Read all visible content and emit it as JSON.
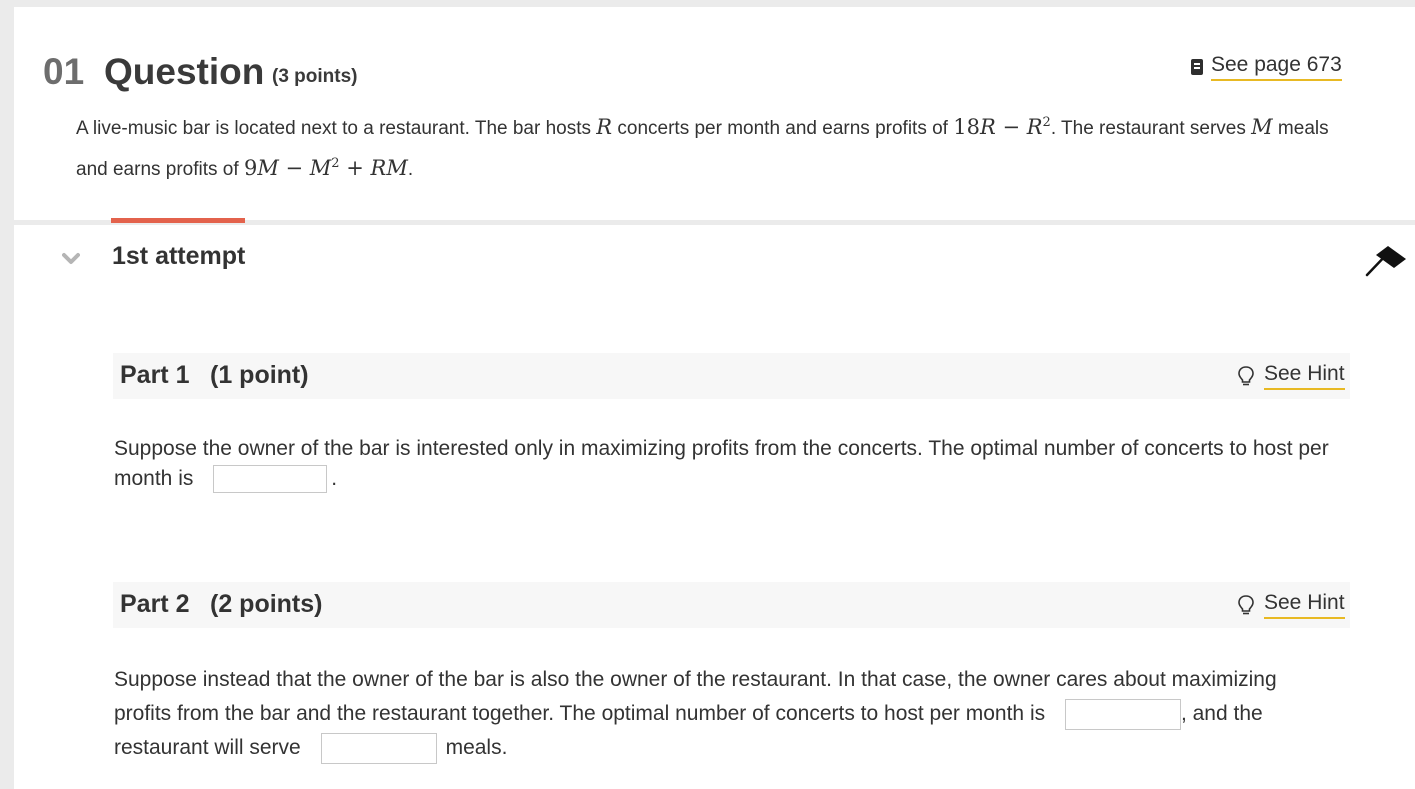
{
  "question": {
    "number": "01",
    "label": "Question",
    "points": "(3 points)",
    "see_page": "See page 673",
    "stem_line1_a": "A live-music bar is located next to a restaurant. The bar hosts ",
    "stem_var_R": "R",
    "stem_line1_b": " concerts per month and earns profits of ",
    "stem_expr1_num": "18",
    "stem_expr1_var": "R",
    "stem_expr1_op": " − ",
    "stem_expr1_var2": "R",
    "stem_expr1_exp": "2",
    "stem_line1_c": ". The restaurant serves ",
    "stem_var_M": "M",
    "stem_line1_d": " meals",
    "stem_line2_a": "and earns profits of ",
    "stem_expr2_num": "9",
    "stem_expr2_var": "M",
    "stem_expr2_op1": " − ",
    "stem_expr2_var2": "M",
    "stem_expr2_exp": "2",
    "stem_expr2_op2": " + ",
    "stem_expr2_var3": "RM",
    "stem_line2_b": "."
  },
  "attempt": {
    "label": "1st attempt"
  },
  "part1": {
    "title": "Part 1",
    "points": "(1 point)",
    "hint": "See Hint",
    "text_a": "Suppose the owner of the bar is interested only in maximizing profits from the concerts. The optimal number of concerts to host per month is",
    "text_b": ".",
    "answer_value": ""
  },
  "part2": {
    "title": "Part 2",
    "points": "(2 points)",
    "hint": "See Hint",
    "text_a": "Suppose instead that the owner of the bar is also the owner of the restaurant. In that case, the owner cares about maximizing profits from the bar and the restaurant together. The optimal number of concerts to host per month is",
    "text_b": ", and the restaurant will serve",
    "text_c": "meals.",
    "answer1_value": "",
    "answer2_value": ""
  },
  "colors": {
    "accent": "#e3624c",
    "link_underline": "#e8b923",
    "gutter": "#ebebeb"
  },
  "icons": {
    "see_page": "book-icon",
    "hint": "lightbulb-icon",
    "collapse": "chevron-down-icon",
    "flag": "flag-icon"
  }
}
